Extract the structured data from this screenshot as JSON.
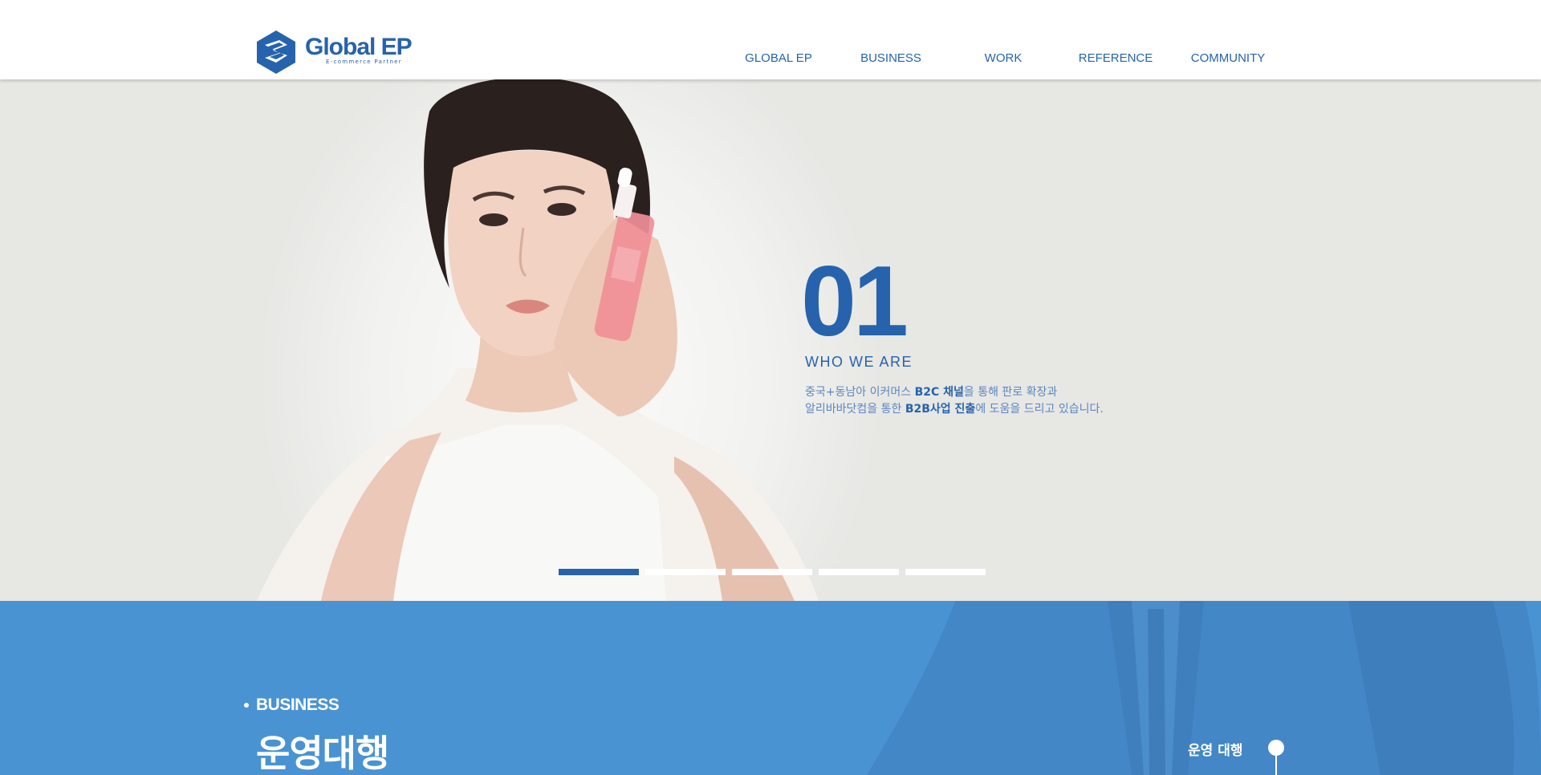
{
  "header": {
    "logo": {
      "name": "Global EP",
      "tagline": "E-commerce Partner"
    },
    "nav": [
      {
        "label": "GLOBAL EP"
      },
      {
        "label": "BUSINESS"
      },
      {
        "label": "WORK"
      },
      {
        "label": "REFERENCE"
      },
      {
        "label": "COMMUNITY"
      }
    ]
  },
  "hero": {
    "number": "01",
    "subtitle": "WHO WE ARE",
    "desc_line1": {
      "pre": "중국+동남아 이커머스 ",
      "bold": "B2C 채널",
      "post": "을 통해 판로 확장과"
    },
    "desc_line2": {
      "pre": "알리바바닷컴을 통한 ",
      "bold": "B2B사업 진출",
      "post": "에 도움을 드리고 있습니다."
    },
    "pager": {
      "count": 5,
      "active_index": 0
    }
  },
  "business": {
    "section_label": "BUSINESS",
    "title": "운영대행",
    "side_label": "운영 대행"
  },
  "colors": {
    "brand_blue": "#2663ac",
    "section_blue": "#4a93d2",
    "hero_bg": "#e7e7e4"
  }
}
